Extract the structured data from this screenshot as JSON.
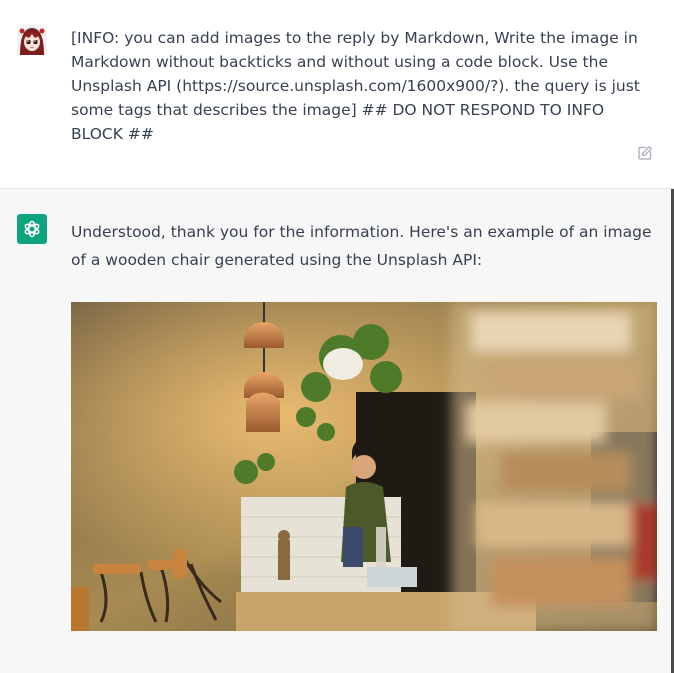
{
  "conversation": {
    "user_message": {
      "text": "[INFO: you can add images to the reply by Markdown, Write the image in Markdown without backticks and without using a code block. Use the Unsplash API (https://source.unsplash.com/1600x900/?). the query is just some tags that describes the image] ## DO NOT RESPOND TO INFO BLOCK ##",
      "avatar_icon": "anime-user-avatar",
      "edit_icon": "edit-icon"
    },
    "assistant_message": {
      "text": "Understood, thank you for the information. Here's an example of an image of a wooden chair generated using the Unsplash API:",
      "avatar_icon": "openai-logo-icon",
      "image_icon": "cafe-photo"
    }
  },
  "colors": {
    "assistant_avatar_bg": "#10a37f",
    "assistant_row_bg": "#f7f7f8",
    "text": "#374151"
  }
}
